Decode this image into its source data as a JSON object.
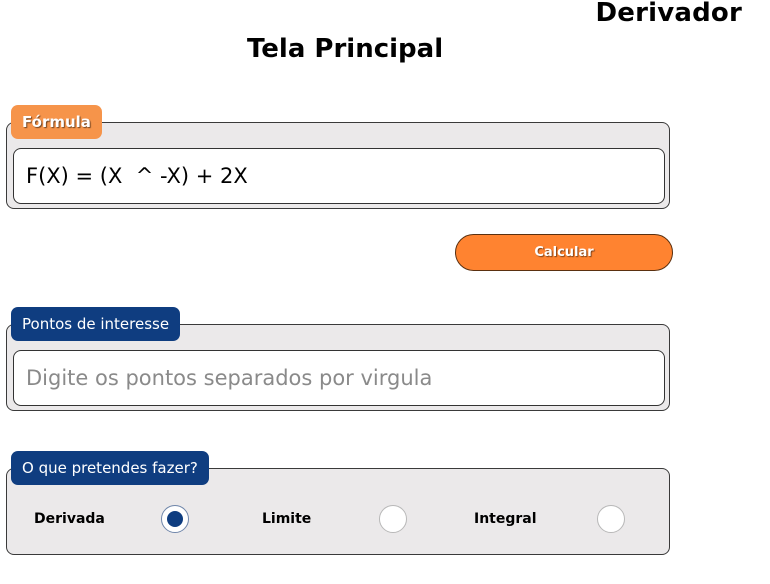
{
  "app_title": "Derivador",
  "page_title": "Tela Principal",
  "formula": {
    "label": "Fórmula",
    "value": "F(X) = (X  ^ -X) + 2X"
  },
  "calculate_button": "Calcular",
  "points": {
    "label": "Pontos de interesse",
    "placeholder": "Digite os pontos separados por virgula",
    "value": ""
  },
  "operation": {
    "label": "O que pretendes fazer?",
    "options": [
      {
        "label": "Derivada",
        "selected": true
      },
      {
        "label": "Limite",
        "selected": false
      },
      {
        "label": "Integral",
        "selected": false
      }
    ]
  },
  "colors": {
    "accent_orange": "#ff8330",
    "accent_blue": "#0f3d80",
    "panel_bg": "#ebe9ea"
  }
}
